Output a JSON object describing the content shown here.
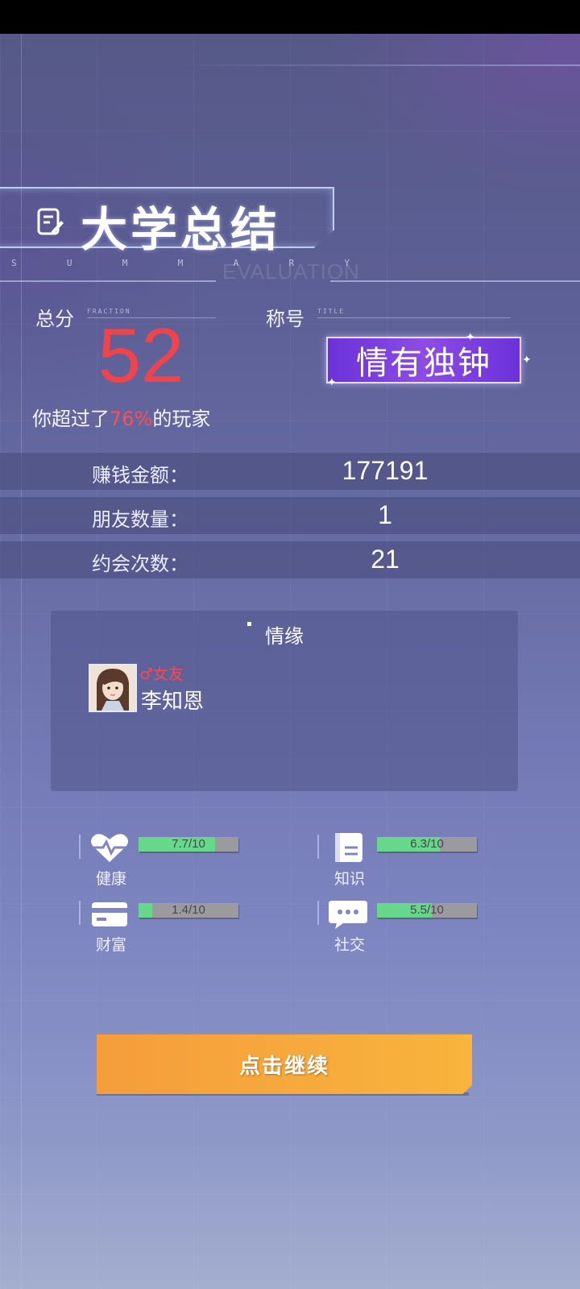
{
  "header": {
    "title": "大学总结",
    "subtitle_letters": [
      "S",
      "U",
      "M",
      "M",
      "A",
      "R",
      "Y"
    ],
    "ghost_text": "EVALUATION"
  },
  "score": {
    "label": "总分",
    "label_en": "FRACTION",
    "value": "52",
    "exceed_prefix": "你超过了",
    "exceed_percent": "76%",
    "exceed_suffix": "的玩家"
  },
  "title": {
    "label": "称号",
    "label_en": "TITLE",
    "value": "情有独钟"
  },
  "stats": [
    {
      "label": "赚钱金额：",
      "value": "177191"
    },
    {
      "label": "朋友数量：",
      "value": "1"
    },
    {
      "label": "约会次数：",
      "value": "21"
    }
  ],
  "relationships": {
    "title": "情缘",
    "items": [
      {
        "tag": "♂女友",
        "name": "李知恩"
      }
    ]
  },
  "attributes": [
    {
      "name": "健康",
      "value_text": "7.7/10",
      "value": 7.7,
      "max": 10,
      "icon": "heart-icon"
    },
    {
      "name": "知识",
      "value_text": "6.3/10",
      "value": 6.3,
      "max": 10,
      "icon": "book-icon"
    },
    {
      "name": "财富",
      "value_text": "1.4/10",
      "value": 1.4,
      "max": 10,
      "icon": "card-icon"
    },
    {
      "name": "社交",
      "value_text": "5.5/10",
      "value": 5.5,
      "max": 10,
      "icon": "chat-icon"
    }
  ],
  "colors": {
    "score": "#f0444c",
    "bar_fill": "#67d88a",
    "bar_empty": "#9b9b9f",
    "button": "#f8b43c",
    "badge": "#8d4ce4"
  },
  "continue_label": "点击继续"
}
